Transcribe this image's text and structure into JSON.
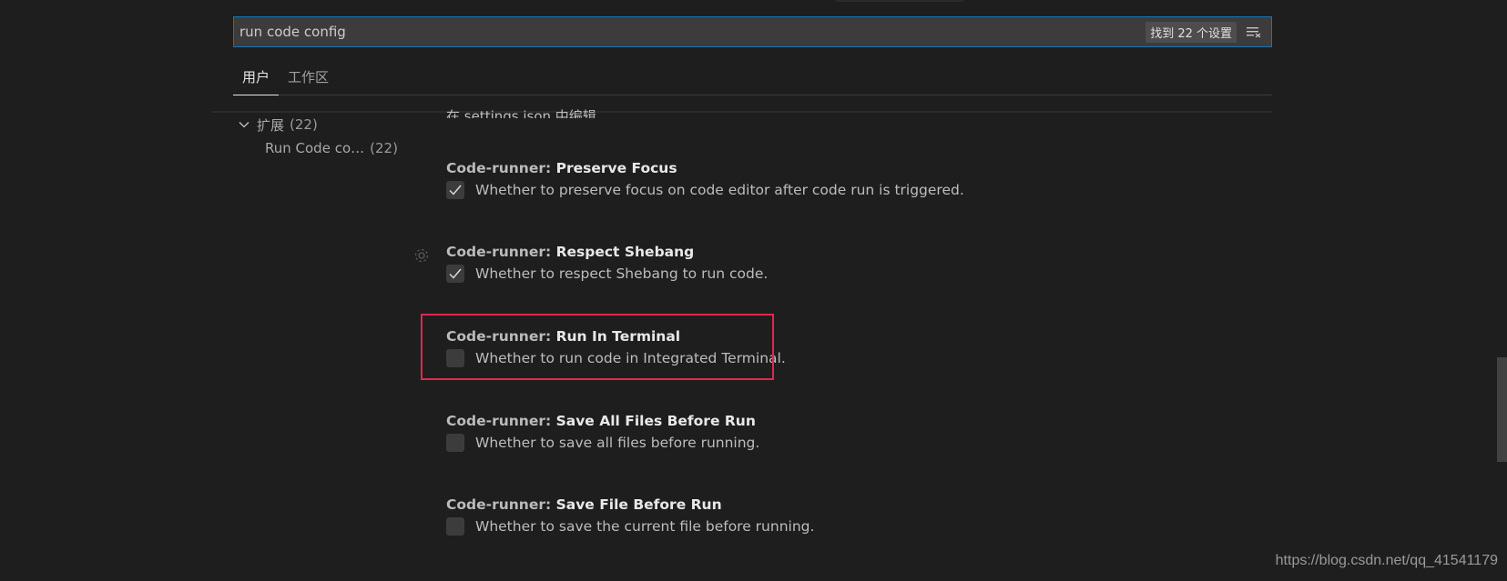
{
  "search": {
    "value": "run code config",
    "result_count": "找到 22 个设置"
  },
  "tabs": [
    {
      "label": "用户"
    },
    {
      "label": "工作区"
    }
  ],
  "toc": {
    "group_label": "扩展",
    "group_count": "(22)",
    "child_label": "Run Code co…",
    "child_count": "(22)"
  },
  "edit_link": "在 settings.json 中编辑",
  "settings": [
    {
      "category": "Code-runner: ",
      "name": "Preserve Focus",
      "description": "Whether to preserve focus on code editor after code run is triggered.",
      "checked": true
    },
    {
      "category": "Code-runner: ",
      "name": "Respect Shebang",
      "description": "Whether to respect Shebang to run code.",
      "checked": true
    },
    {
      "category": "Code-runner: ",
      "name": "Run In Terminal",
      "description": "Whether to run code in Integrated Terminal.",
      "checked": false
    },
    {
      "category": "Code-runner: ",
      "name": "Save All Files Before Run",
      "description": "Whether to save all files before running.",
      "checked": false
    },
    {
      "category": "Code-runner: ",
      "name": "Save File Before Run",
      "description": "Whether to save the current file before running.",
      "checked": false
    }
  ],
  "watermark": "https://blog.csdn.net/qq_41541179",
  "colors": {
    "background": "#1e1e1e",
    "focus_border": "#1177bb",
    "highlight": "#e0284f"
  }
}
